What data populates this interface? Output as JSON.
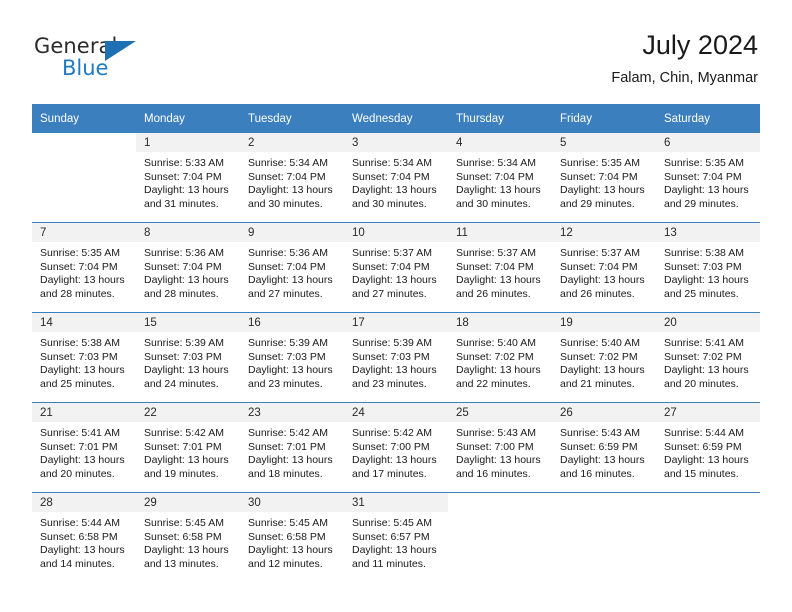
{
  "brand": {
    "word_one": "General",
    "word_two": "Blue",
    "flag_icon": "triangle-flag-icon"
  },
  "header": {
    "month_title": "July 2024",
    "location": "Falam, Chin, Myanmar"
  },
  "colors": {
    "header_blue": "#3b7fbf",
    "brand_blue": "#1f7ac0",
    "daynum_band": "#f2f2f2",
    "text": "#1a1a1a"
  },
  "calendar": {
    "weekdays": [
      "Sunday",
      "Monday",
      "Tuesday",
      "Wednesday",
      "Thursday",
      "Friday",
      "Saturday"
    ],
    "weeks": [
      [
        {
          "day": "",
          "sunrise": "",
          "sunset": "",
          "daylight_line1": "",
          "daylight_line2": ""
        },
        {
          "day": "1",
          "sunrise": "Sunrise: 5:33 AM",
          "sunset": "Sunset: 7:04 PM",
          "daylight_line1": "Daylight: 13 hours",
          "daylight_line2": "and 31 minutes."
        },
        {
          "day": "2",
          "sunrise": "Sunrise: 5:34 AM",
          "sunset": "Sunset: 7:04 PM",
          "daylight_line1": "Daylight: 13 hours",
          "daylight_line2": "and 30 minutes."
        },
        {
          "day": "3",
          "sunrise": "Sunrise: 5:34 AM",
          "sunset": "Sunset: 7:04 PM",
          "daylight_line1": "Daylight: 13 hours",
          "daylight_line2": "and 30 minutes."
        },
        {
          "day": "4",
          "sunrise": "Sunrise: 5:34 AM",
          "sunset": "Sunset: 7:04 PM",
          "daylight_line1": "Daylight: 13 hours",
          "daylight_line2": "and 30 minutes."
        },
        {
          "day": "5",
          "sunrise": "Sunrise: 5:35 AM",
          "sunset": "Sunset: 7:04 PM",
          "daylight_line1": "Daylight: 13 hours",
          "daylight_line2": "and 29 minutes."
        },
        {
          "day": "6",
          "sunrise": "Sunrise: 5:35 AM",
          "sunset": "Sunset: 7:04 PM",
          "daylight_line1": "Daylight: 13 hours",
          "daylight_line2": "and 29 minutes."
        }
      ],
      [
        {
          "day": "7",
          "sunrise": "Sunrise: 5:35 AM",
          "sunset": "Sunset: 7:04 PM",
          "daylight_line1": "Daylight: 13 hours",
          "daylight_line2": "and 28 minutes."
        },
        {
          "day": "8",
          "sunrise": "Sunrise: 5:36 AM",
          "sunset": "Sunset: 7:04 PM",
          "daylight_line1": "Daylight: 13 hours",
          "daylight_line2": "and 28 minutes."
        },
        {
          "day": "9",
          "sunrise": "Sunrise: 5:36 AM",
          "sunset": "Sunset: 7:04 PM",
          "daylight_line1": "Daylight: 13 hours",
          "daylight_line2": "and 27 minutes."
        },
        {
          "day": "10",
          "sunrise": "Sunrise: 5:37 AM",
          "sunset": "Sunset: 7:04 PM",
          "daylight_line1": "Daylight: 13 hours",
          "daylight_line2": "and 27 minutes."
        },
        {
          "day": "11",
          "sunrise": "Sunrise: 5:37 AM",
          "sunset": "Sunset: 7:04 PM",
          "daylight_line1": "Daylight: 13 hours",
          "daylight_line2": "and 26 minutes."
        },
        {
          "day": "12",
          "sunrise": "Sunrise: 5:37 AM",
          "sunset": "Sunset: 7:04 PM",
          "daylight_line1": "Daylight: 13 hours",
          "daylight_line2": "and 26 minutes."
        },
        {
          "day": "13",
          "sunrise": "Sunrise: 5:38 AM",
          "sunset": "Sunset: 7:03 PM",
          "daylight_line1": "Daylight: 13 hours",
          "daylight_line2": "and 25 minutes."
        }
      ],
      [
        {
          "day": "14",
          "sunrise": "Sunrise: 5:38 AM",
          "sunset": "Sunset: 7:03 PM",
          "daylight_line1": "Daylight: 13 hours",
          "daylight_line2": "and 25 minutes."
        },
        {
          "day": "15",
          "sunrise": "Sunrise: 5:39 AM",
          "sunset": "Sunset: 7:03 PM",
          "daylight_line1": "Daylight: 13 hours",
          "daylight_line2": "and 24 minutes."
        },
        {
          "day": "16",
          "sunrise": "Sunrise: 5:39 AM",
          "sunset": "Sunset: 7:03 PM",
          "daylight_line1": "Daylight: 13 hours",
          "daylight_line2": "and 23 minutes."
        },
        {
          "day": "17",
          "sunrise": "Sunrise: 5:39 AM",
          "sunset": "Sunset: 7:03 PM",
          "daylight_line1": "Daylight: 13 hours",
          "daylight_line2": "and 23 minutes."
        },
        {
          "day": "18",
          "sunrise": "Sunrise: 5:40 AM",
          "sunset": "Sunset: 7:02 PM",
          "daylight_line1": "Daylight: 13 hours",
          "daylight_line2": "and 22 minutes."
        },
        {
          "day": "19",
          "sunrise": "Sunrise: 5:40 AM",
          "sunset": "Sunset: 7:02 PM",
          "daylight_line1": "Daylight: 13 hours",
          "daylight_line2": "and 21 minutes."
        },
        {
          "day": "20",
          "sunrise": "Sunrise: 5:41 AM",
          "sunset": "Sunset: 7:02 PM",
          "daylight_line1": "Daylight: 13 hours",
          "daylight_line2": "and 20 minutes."
        }
      ],
      [
        {
          "day": "21",
          "sunrise": "Sunrise: 5:41 AM",
          "sunset": "Sunset: 7:01 PM",
          "daylight_line1": "Daylight: 13 hours",
          "daylight_line2": "and 20 minutes."
        },
        {
          "day": "22",
          "sunrise": "Sunrise: 5:42 AM",
          "sunset": "Sunset: 7:01 PM",
          "daylight_line1": "Daylight: 13 hours",
          "daylight_line2": "and 19 minutes."
        },
        {
          "day": "23",
          "sunrise": "Sunrise: 5:42 AM",
          "sunset": "Sunset: 7:01 PM",
          "daylight_line1": "Daylight: 13 hours",
          "daylight_line2": "and 18 minutes."
        },
        {
          "day": "24",
          "sunrise": "Sunrise: 5:42 AM",
          "sunset": "Sunset: 7:00 PM",
          "daylight_line1": "Daylight: 13 hours",
          "daylight_line2": "and 17 minutes."
        },
        {
          "day": "25",
          "sunrise": "Sunrise: 5:43 AM",
          "sunset": "Sunset: 7:00 PM",
          "daylight_line1": "Daylight: 13 hours",
          "daylight_line2": "and 16 minutes."
        },
        {
          "day": "26",
          "sunrise": "Sunrise: 5:43 AM",
          "sunset": "Sunset: 6:59 PM",
          "daylight_line1": "Daylight: 13 hours",
          "daylight_line2": "and 16 minutes."
        },
        {
          "day": "27",
          "sunrise": "Sunrise: 5:44 AM",
          "sunset": "Sunset: 6:59 PM",
          "daylight_line1": "Daylight: 13 hours",
          "daylight_line2": "and 15 minutes."
        }
      ],
      [
        {
          "day": "28",
          "sunrise": "Sunrise: 5:44 AM",
          "sunset": "Sunset: 6:58 PM",
          "daylight_line1": "Daylight: 13 hours",
          "daylight_line2": "and 14 minutes."
        },
        {
          "day": "29",
          "sunrise": "Sunrise: 5:45 AM",
          "sunset": "Sunset: 6:58 PM",
          "daylight_line1": "Daylight: 13 hours",
          "daylight_line2": "and 13 minutes."
        },
        {
          "day": "30",
          "sunrise": "Sunrise: 5:45 AM",
          "sunset": "Sunset: 6:58 PM",
          "daylight_line1": "Daylight: 13 hours",
          "daylight_line2": "and 12 minutes."
        },
        {
          "day": "31",
          "sunrise": "Sunrise: 5:45 AM",
          "sunset": "Sunset: 6:57 PM",
          "daylight_line1": "Daylight: 13 hours",
          "daylight_line2": "and 11 minutes."
        },
        {
          "day": "",
          "sunrise": "",
          "sunset": "",
          "daylight_line1": "",
          "daylight_line2": ""
        },
        {
          "day": "",
          "sunrise": "",
          "sunset": "",
          "daylight_line1": "",
          "daylight_line2": ""
        },
        {
          "day": "",
          "sunrise": "",
          "sunset": "",
          "daylight_line1": "",
          "daylight_line2": ""
        }
      ]
    ]
  }
}
